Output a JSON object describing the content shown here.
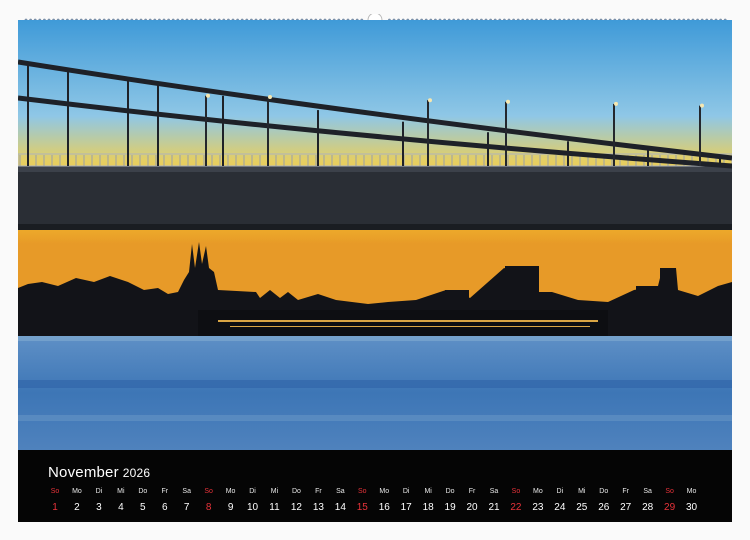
{
  "calendar": {
    "month": "November",
    "year": "2026",
    "accent_sunday": "#e8333a",
    "days": [
      {
        "dn": "So",
        "d": "1",
        "sun": true
      },
      {
        "dn": "Mo",
        "d": "2"
      },
      {
        "dn": "Di",
        "d": "3"
      },
      {
        "dn": "Mi",
        "d": "4"
      },
      {
        "dn": "Do",
        "d": "5"
      },
      {
        "dn": "Fr",
        "d": "6"
      },
      {
        "dn": "Sa",
        "d": "7"
      },
      {
        "dn": "So",
        "d": "8",
        "sun": true
      },
      {
        "dn": "Mo",
        "d": "9"
      },
      {
        "dn": "Di",
        "d": "10"
      },
      {
        "dn": "Mi",
        "d": "11"
      },
      {
        "dn": "Do",
        "d": "12"
      },
      {
        "dn": "Fr",
        "d": "13"
      },
      {
        "dn": "Sa",
        "d": "14"
      },
      {
        "dn": "So",
        "d": "15",
        "sun": true
      },
      {
        "dn": "Mo",
        "d": "16"
      },
      {
        "dn": "Di",
        "d": "17"
      },
      {
        "dn": "Mi",
        "d": "18"
      },
      {
        "dn": "Do",
        "d": "19"
      },
      {
        "dn": "Fr",
        "d": "20"
      },
      {
        "dn": "Sa",
        "d": "21"
      },
      {
        "dn": "So",
        "d": "22",
        "sun": true
      },
      {
        "dn": "Mo",
        "d": "23"
      },
      {
        "dn": "Di",
        "d": "24"
      },
      {
        "dn": "Mi",
        "d": "25"
      },
      {
        "dn": "Do",
        "d": "26"
      },
      {
        "dn": "Fr",
        "d": "27"
      },
      {
        "dn": "Sa",
        "d": "28"
      },
      {
        "dn": "So",
        "d": "29",
        "sun": true
      },
      {
        "dn": "Mo",
        "d": "30"
      }
    ]
  },
  "photo": {
    "sky_top": "#4fa7e0",
    "sky_horizon": "#f2c23a",
    "water": "#3f79b8",
    "bridge": "#2a2e35"
  }
}
